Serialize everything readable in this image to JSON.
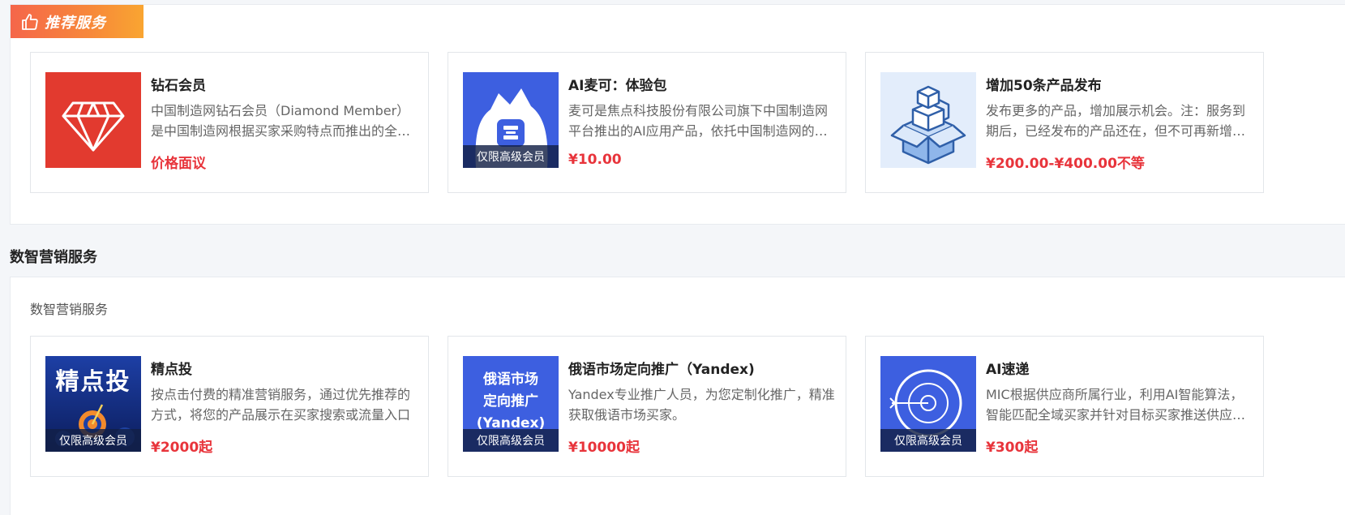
{
  "recommended": {
    "badge_label": "推荐服务",
    "cards": [
      {
        "title": "钻石会员",
        "description": "中国制造网钻石会员（Diamond Member）是中国制造网根据买家采购特点而推出的全新会员服务",
        "price": "价格面议",
        "icon": "diamond-icon",
        "image_bg": "#e23a2f"
      },
      {
        "title": "AI麦可：体验包",
        "description": "麦可是焦点科技股份有限公司旗下中国制造网平台推出的AI应用产品，依托中国制造网的海量数据",
        "price": "¥10.00",
        "tag": "仅限高级会员",
        "icon": "ai-mascot-icon",
        "image_bg": "#3d5fe0"
      },
      {
        "title": "增加50条产品发布",
        "description": "发布更多的产品，增加展示机会。注：服务到期后，已经发布的产品还在，但不可再新增发布",
        "price": "¥200.00-¥400.00不等",
        "icon": "boxes-icon",
        "image_bg": "#e3edfb"
      }
    ]
  },
  "marketing": {
    "section_title": "数智营销服务",
    "subtitle": "数智营销服务",
    "cards": [
      {
        "title": "精点投",
        "description": "按点击付费的精准营销服务，通过优先推荐的方式，将您的产品展示在买家搜索或流量入口",
        "price": "¥2000起",
        "tag": "仅限高级会员",
        "image_text": "精点投",
        "icon": "target-icon"
      },
      {
        "title": "俄语市场定向推广（Yandex)",
        "description": "Yandex专业推广人员，为您定制化推广，精准获取俄语市场买家。",
        "price": "¥10000起",
        "tag": "仅限高级会员",
        "image_text_lines": [
          "俄语市场",
          "定向推广",
          "(Yandex)"
        ]
      },
      {
        "title": "AI速递",
        "description": "MIC根据供应商所属行业，利用AI智能算法，智能匹配全域买家并针对目标买家推送供应商信息",
        "price": "¥300起",
        "tag": "仅限高级会员",
        "icon": "target-arrow-icon"
      }
    ]
  },
  "colors": {
    "price": "#e8343b",
    "badge_gradient_start": "#f5664a",
    "badge_gradient_end": "#f9a531",
    "brand_blue": "#3d5fe0"
  }
}
